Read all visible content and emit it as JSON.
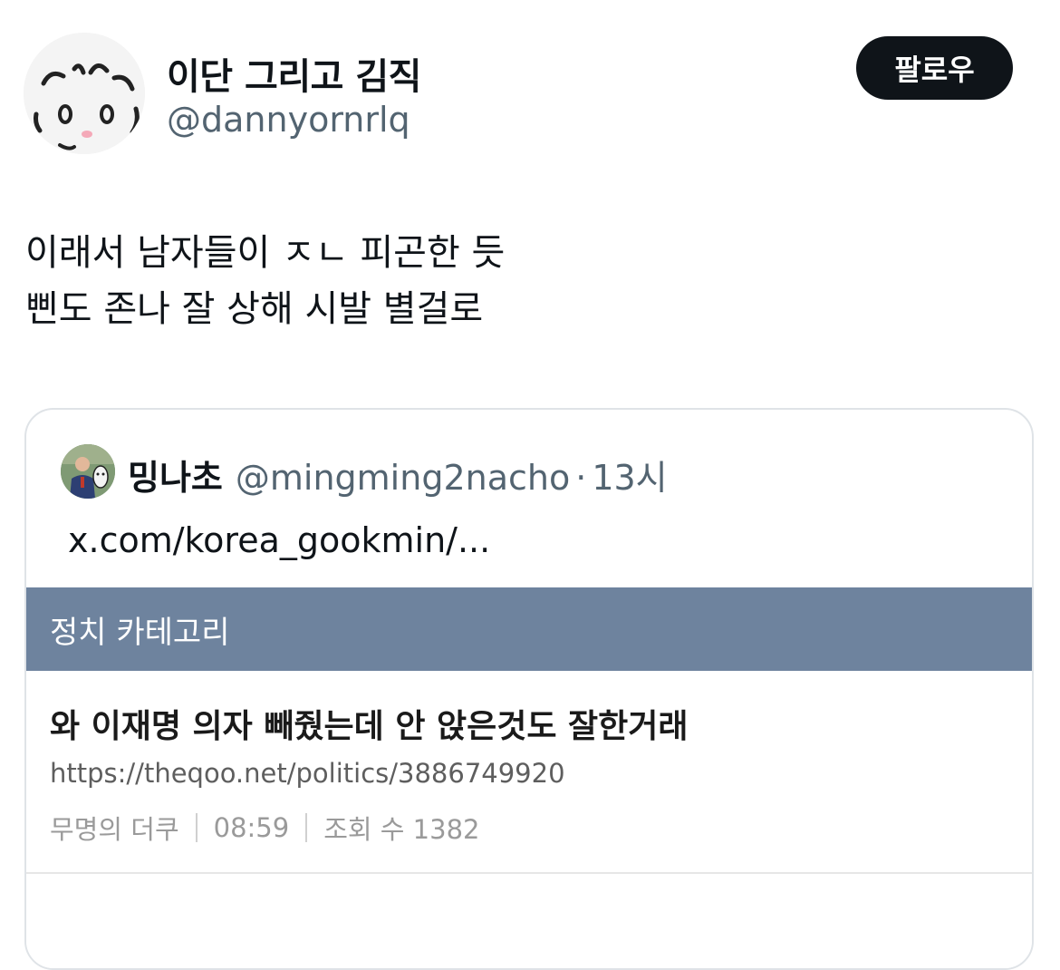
{
  "author": {
    "display_name": "이단 그리고 김직",
    "handle": "@dannyornrlq",
    "avatar_icon": "hamster-drawing-avatar"
  },
  "follow_button": {
    "label": "팔로우"
  },
  "tweet": {
    "lines": [
      "이래서 남자들이 ㅈㄴ 피곤한 듯",
      "삔도 존나 잘 상해 시발 별걸로"
    ]
  },
  "quote": {
    "display_name": "밍나초",
    "handle": "@mingming2nacho",
    "dot": "·",
    "time": "13시",
    "link_text": "x.com/korea_gookmin/...",
    "media": {
      "category_bar": "정치 카테고리",
      "title": "와 이재명 의자 빼줬는데 안 앉은것도 잘한거래",
      "url": "https://theqoo.net/politics/3886749920",
      "meta": {
        "author": "무명의 더쿠",
        "time": "08:59",
        "views": "조회 수 1382"
      }
    }
  },
  "colors": {
    "text": "#0f1419",
    "secondary": "#536471",
    "button_bg": "#0f1419",
    "category_bar": "#6e839e"
  }
}
